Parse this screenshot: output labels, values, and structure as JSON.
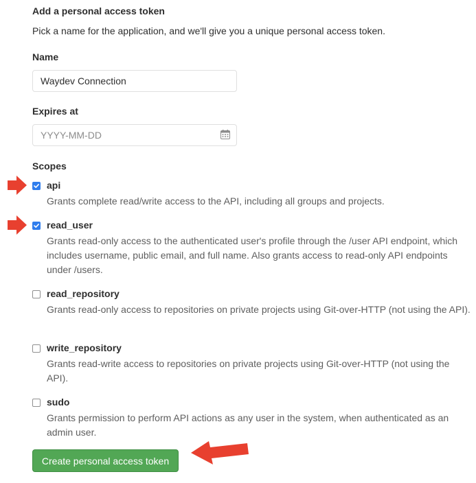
{
  "form": {
    "heading": "Add a personal access token",
    "intro": "Pick a name for the application, and we'll give you a unique personal access token.",
    "name_label": "Name",
    "name_value": "Waydev Connection",
    "expires_label": "Expires at",
    "expires_placeholder": "YYYY-MM-DD",
    "expires_icon": "calendar-icon",
    "scopes_label": "Scopes",
    "scopes": [
      {
        "name": "api",
        "checked": true,
        "description": "Grants complete read/write access to the API, including all groups and projects."
      },
      {
        "name": "read_user",
        "checked": true,
        "description": "Grants read-only access to the authenticated user's profile through the /user API endpoint, which includes username, public email, and full name. Also grants access to read-only API endpoints under /users."
      },
      {
        "name": "read_repository",
        "checked": false,
        "description": "Grants read-only access to repositories on private projects using Git-over-HTTP (not using the API)."
      },
      {
        "name": "write_repository",
        "checked": false,
        "description": "Grants read-write access to repositories on private projects using Git-over-HTTP (not using the API)."
      },
      {
        "name": "sudo",
        "checked": false,
        "description": "Grants permission to perform API actions as any user in the system, when authenticated as an admin user."
      }
    ],
    "submit_label": "Create personal access token"
  },
  "annotations": {
    "arrow_icon": "red-arrow-icon",
    "arrow_color": "#e8402f"
  },
  "colors": {
    "checkbox_checked": "#2f7ded",
    "submit_button": "#52a755",
    "description_text": "#5e5e5e"
  }
}
